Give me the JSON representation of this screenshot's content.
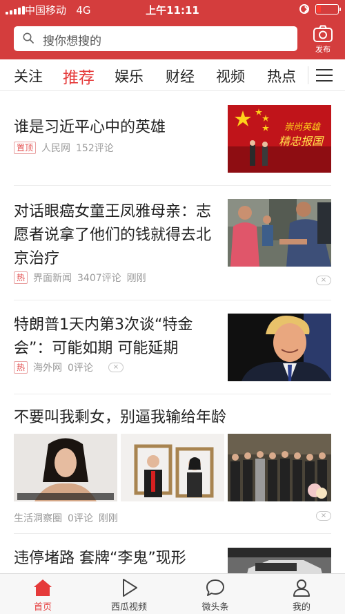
{
  "status_bar": {
    "carrier": "中国移动",
    "network": "4G",
    "time": "上午11:11",
    "icons": [
      "signal-icon",
      "orientation-lock-icon",
      "battery-icon"
    ]
  },
  "header": {
    "search_placeholder": "搜你想搜的",
    "publish_label": "发布",
    "colors": {
      "header_red": "#d43d3d",
      "accent_red": "#e53a3a"
    }
  },
  "tabs": [
    {
      "label": "关注",
      "active": false
    },
    {
      "label": "推荐",
      "active": true
    },
    {
      "label": "娱乐",
      "active": false
    },
    {
      "label": "财经",
      "active": false
    },
    {
      "label": "视频",
      "active": false
    },
    {
      "label": "热点",
      "active": false
    }
  ],
  "feed": [
    {
      "title": "谁是习近平心中的英雄",
      "tag": "置顶",
      "source": "人民网",
      "comments": "152评论",
      "time": "",
      "image_text": [
        "崇尚英雄",
        "精忠报国"
      ]
    },
    {
      "title": "对话眼癌女童王凤雅母亲：志愿者说拿了他们的钱就得去北京治疗",
      "tag": "热",
      "source": "界面新闻",
      "comments": "3407评论",
      "time": "刚刚",
      "dismiss": "×"
    },
    {
      "title": "特朗普1天内第3次谈“特金会”：可能如期 可能延期",
      "tag": "热",
      "source": "海外网",
      "comments": "0评论",
      "time": "",
      "dismiss": "×"
    },
    {
      "title": "不要叫我剩女，别逼我输给年龄",
      "tag": "",
      "source": "生活洞察圈",
      "comments": "0评论",
      "time": "刚刚",
      "dismiss": "×"
    },
    {
      "title": "违停堵路 套牌“李鬼”现形",
      "tag": "",
      "source": "",
      "comments": "",
      "time": ""
    }
  ],
  "bottom_nav": [
    {
      "label": "首页",
      "icon": "home-icon",
      "active": true
    },
    {
      "label": "西瓜视频",
      "icon": "play-icon",
      "active": false
    },
    {
      "label": "微头条",
      "icon": "chat-bubble-icon",
      "active": false
    },
    {
      "label": "我的",
      "icon": "user-icon",
      "active": false
    }
  ]
}
